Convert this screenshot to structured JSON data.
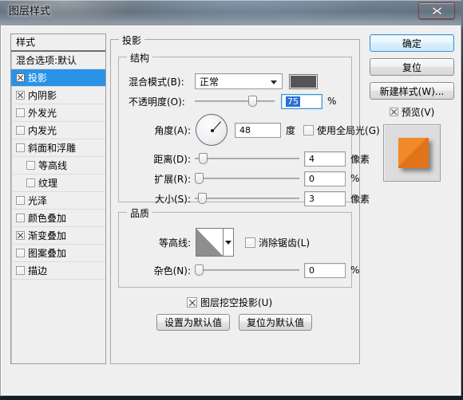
{
  "window": {
    "title": "图层样式",
    "close_icon": "close-x-icon"
  },
  "styles_panel": {
    "header": "样式",
    "items": [
      {
        "label": "混合选项:默认",
        "checkbox": false,
        "has_checkbox": false,
        "indent": 0,
        "selected": false
      },
      {
        "label": "投影",
        "checkbox": true,
        "has_checkbox": true,
        "indent": 0,
        "selected": true
      },
      {
        "label": "内阴影",
        "checkbox": true,
        "has_checkbox": true,
        "indent": 0,
        "selected": false
      },
      {
        "label": "外发光",
        "checkbox": false,
        "has_checkbox": true,
        "indent": 0,
        "selected": false
      },
      {
        "label": "内发光",
        "checkbox": false,
        "has_checkbox": true,
        "indent": 0,
        "selected": false
      },
      {
        "label": "斜面和浮雕",
        "checkbox": false,
        "has_checkbox": true,
        "indent": 0,
        "selected": false
      },
      {
        "label": "等高线",
        "checkbox": false,
        "has_checkbox": true,
        "indent": 1,
        "selected": false
      },
      {
        "label": "纹理",
        "checkbox": false,
        "has_checkbox": true,
        "indent": 1,
        "selected": false
      },
      {
        "label": "光泽",
        "checkbox": false,
        "has_checkbox": true,
        "indent": 0,
        "selected": false
      },
      {
        "label": "颜色叠加",
        "checkbox": false,
        "has_checkbox": true,
        "indent": 0,
        "selected": false
      },
      {
        "label": "渐变叠加",
        "checkbox": true,
        "has_checkbox": true,
        "indent": 0,
        "selected": false
      },
      {
        "label": "图案叠加",
        "checkbox": false,
        "has_checkbox": true,
        "indent": 0,
        "selected": false
      },
      {
        "label": "描边",
        "checkbox": false,
        "has_checkbox": true,
        "indent": 0,
        "selected": false
      }
    ]
  },
  "actions": {
    "ok": "确定",
    "reset": "复位",
    "new_style": "新建样式(W)...",
    "preview": "预览(V)",
    "preview_checked": true
  },
  "main": {
    "group_title": "投影",
    "structure": {
      "title": "结构",
      "blend_mode_label": "混合模式(B):",
      "blend_mode_value": "正常",
      "shadow_color": "#555555",
      "opacity_label": "不透明度(O):",
      "opacity_value": "75",
      "opacity_unit": "%",
      "opacity_percent": 75,
      "angle_label": "角度(A):",
      "angle_value": "48",
      "angle_unit": "度",
      "global_light_label": "使用全局光(G)",
      "global_light_checked": false,
      "distance_label": "距离(D):",
      "distance_value": "4",
      "distance_unit": "像素",
      "distance_percent": 4,
      "spread_label": "扩展(R):",
      "spread_value": "0",
      "spread_unit": "%",
      "spread_percent": 0,
      "size_label": "大小(S):",
      "size_value": "3",
      "size_unit": "像素",
      "size_percent": 3
    },
    "quality": {
      "title": "品质",
      "contour_label": "等高线:",
      "antialias_label": "消除锯齿(L)",
      "antialias_checked": false,
      "noise_label": "杂色(N):",
      "noise_value": "0",
      "noise_unit": "%",
      "noise_percent": 0
    },
    "knockout_label": "图层挖空投影(U)",
    "knockout_checked": true,
    "set_default": "设置为默认值",
    "reset_default": "复位为默认值"
  }
}
